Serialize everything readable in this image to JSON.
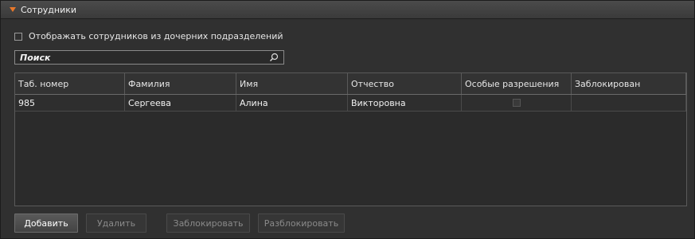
{
  "panel": {
    "title": "Сотрудники"
  },
  "filters": {
    "include_children_label": "Отображать сотрудников из дочерних подразделений",
    "include_children_checked": false,
    "search_placeholder": "Поиск",
    "search_value": ""
  },
  "table": {
    "columns": [
      "Таб. номер",
      "Фамилия",
      "Имя",
      "Отчество",
      "Особые разрешения",
      "Заблокирован"
    ],
    "rows": [
      {
        "tab_number": "985",
        "last_name": "Сергеева",
        "first_name": "Алина",
        "middle_name": "Викторовна",
        "special_permissions": false,
        "blocked": ""
      }
    ]
  },
  "actions": {
    "add": "Добавить",
    "delete": "Удалить",
    "block": "Заблокировать",
    "unblock": "Разблокировать"
  },
  "colors": {
    "accent": "#e8782a",
    "background": "#303030"
  }
}
